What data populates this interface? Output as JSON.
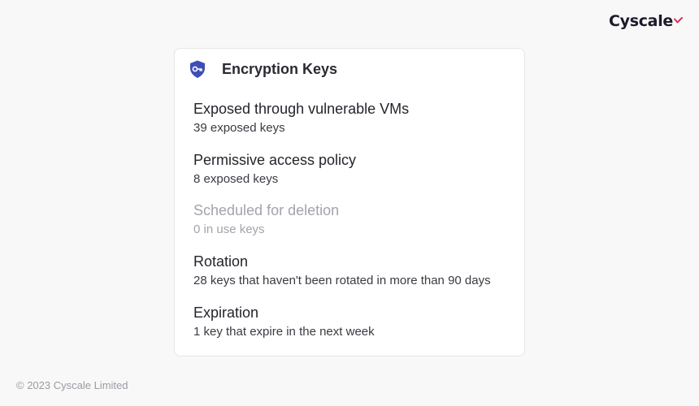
{
  "brand": {
    "name": "Cyscale",
    "accent_color": "#d6345a"
  },
  "card": {
    "title": "Encryption Keys",
    "icon": "shield-key-icon",
    "icon_color": "#3f4db8",
    "items": [
      {
        "title": "Exposed through vulnerable VMs",
        "subtitle": "39 exposed keys"
      },
      {
        "title": "Permissive access policy",
        "subtitle": "8 exposed keys"
      },
      {
        "title": "Scheduled for deletion",
        "subtitle": "0 in use keys",
        "muted": true
      },
      {
        "title": "Rotation",
        "subtitle": "28 keys that haven't been rotated in more than 90 days"
      },
      {
        "title": "Expiration",
        "subtitle": "1 key that expire in the next week"
      }
    ]
  },
  "footer": {
    "copyright": "© 2023 Cyscale Limited"
  }
}
